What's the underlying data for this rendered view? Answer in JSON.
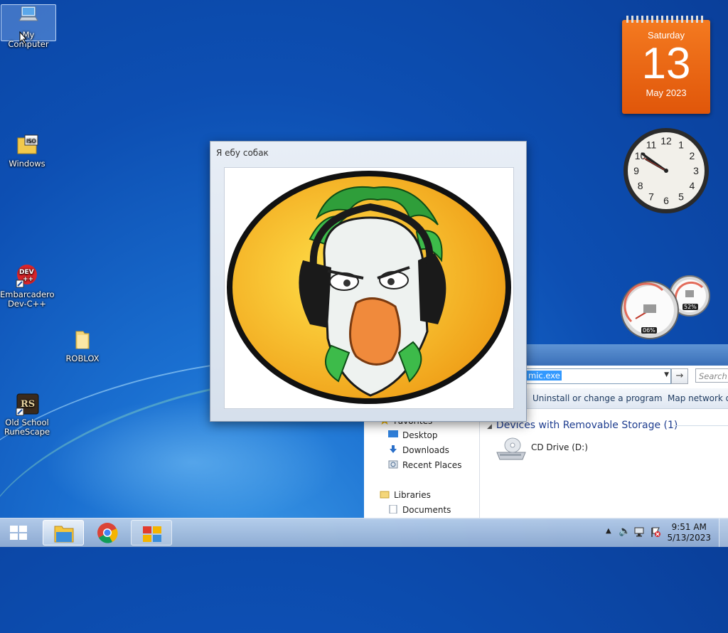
{
  "desktop": {
    "icons": [
      {
        "label": "My Computer",
        "icon": "computer-icon"
      },
      {
        "label": "Windows",
        "icon": "iso-file-icon"
      },
      {
        "label": "Embarcadero Dev-C++",
        "icon": "devcpp-icon"
      },
      {
        "label": "ROBLOX",
        "icon": "folder-icon"
      },
      {
        "label": "Old School RuneScape",
        "icon": "runescape-icon"
      }
    ]
  },
  "gadgets": {
    "calendar": {
      "weekday": "Saturday",
      "day": "13",
      "month_year": "May 2023",
      "color": "#f26b1d"
    },
    "clock": {
      "numerals": [
        "12",
        "1",
        "2",
        "3",
        "4",
        "5",
        "6",
        "7",
        "8",
        "9",
        "10",
        "11"
      ]
    },
    "cpu_meter": {
      "cpu_percent": "06%",
      "memory_percent": "52%"
    }
  },
  "photo_window": {
    "title": "Я ебу собак",
    "image": "cartoon-goose-with-headphones"
  },
  "explorer": {
    "address_value": "mic.exe",
    "search_placeholder": "Search N",
    "commands": [
      "Uninstall or change a program",
      "Map network dr"
    ],
    "nav": {
      "favorites": "Favorites",
      "desktop": "Desktop",
      "downloads": "Downloads",
      "recent": "Recent Places",
      "libraries": "Libraries",
      "documents": "Documents"
    },
    "group_header": "Devices with Removable Storage (1)",
    "drive_label": "CD Drive (D:)"
  },
  "taskbar": {
    "apps": [
      {
        "name": "File Explorer",
        "icon": "folder-icon",
        "state": "active"
      },
      {
        "name": "Google Chrome",
        "icon": "chrome-icon",
        "state": "pinned"
      },
      {
        "name": "App",
        "icon": "app-window-icon",
        "state": "running"
      }
    ],
    "tray": {
      "time": "9:51 AM",
      "date": "5/13/2023"
    }
  }
}
